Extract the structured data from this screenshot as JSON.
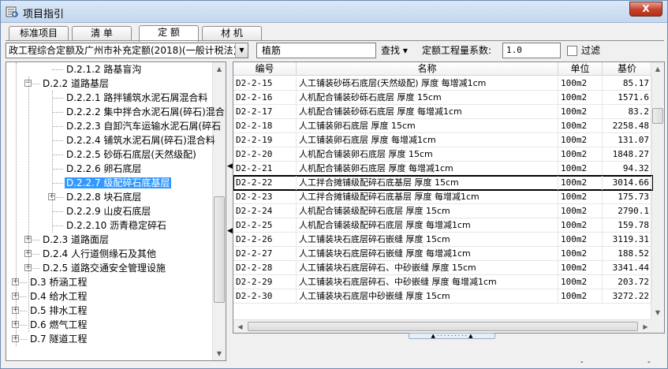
{
  "window": {
    "title": "项目指引",
    "close_label": "X"
  },
  "tabs": [
    {
      "label": "标准项目",
      "active": false
    },
    {
      "label": "清 单",
      "active": false
    },
    {
      "label": "定 额",
      "active": true
    },
    {
      "label": "材 机",
      "active": false
    }
  ],
  "toolbar": {
    "quota_select_value": "政工程综合定额及广州市补充定额(2018)(一般计税法)",
    "search_value": "植筋",
    "find_label": "查找 ▾",
    "coef_label": "定额工程量系数:",
    "coef_value": "1.0",
    "filter_label": "过滤",
    "filter_checked": false
  },
  "tree": {
    "rows": [
      {
        "label": "D.2.1.2 路基盲沟",
        "expander": ""
      },
      {
        "label": "D.2.2 道路基层",
        "expander": "−"
      },
      {
        "label": "D.2.2.1 路拌铺筑水泥石屑混合料",
        "expander": ""
      },
      {
        "label": "D.2.2.2 集中拌合水泥石屑(碎石)混合",
        "expander": ""
      },
      {
        "label": "D.2.2.3 自卸汽车运输水泥石屑(碎石",
        "expander": ""
      },
      {
        "label": "D.2.2.4 铺筑水泥石屑(碎石)混合料",
        "expander": ""
      },
      {
        "label": "D.2.2.5 砂砾石底层(天然级配)",
        "expander": ""
      },
      {
        "label": "D.2.2.6 卵石底层",
        "expander": ""
      },
      {
        "label": "D.2.2.7 级配碎石底基层",
        "expander": "",
        "selected": true
      },
      {
        "label": "D.2.2.8 块石底层",
        "expander": "+"
      },
      {
        "label": "D.2.2.9 山皮石底层",
        "expander": ""
      },
      {
        "label": "D.2.2.10 沥青稳定碎石",
        "expander": ""
      },
      {
        "label": "D.2.3 道路面层",
        "expander": "+"
      },
      {
        "label": "D.2.4 人行道侧缘石及其他",
        "expander": "+"
      },
      {
        "label": "D.2.5 道路交通安全管理设施",
        "expander": "+"
      },
      {
        "label": "D.3 桥涵工程",
        "expander": "+"
      },
      {
        "label": "D.4 给水工程",
        "expander": "+"
      },
      {
        "label": "D.5 排水工程",
        "expander": "+"
      },
      {
        "label": "D.6 燃气工程",
        "expander": "+"
      },
      {
        "label": "D.7 隧道工程",
        "expander": "+"
      }
    ]
  },
  "grid": {
    "columns": [
      "编号",
      "名称",
      "单位",
      "基价"
    ],
    "rows": [
      {
        "code": "D2-2-15",
        "name": "人工铺装砂砾石底层(天然级配) 厚度 每增减1cm",
        "unit": "100m2",
        "price": "85.17"
      },
      {
        "code": "D2-2-16",
        "name": "人机配合铺装砂砾石底层 厚度 15cm",
        "unit": "100m2",
        "price": "1571.6"
      },
      {
        "code": "D2-2-17",
        "name": "人机配合铺装砂砾石底层 厚度 每增减1cm",
        "unit": "100m2",
        "price": "83.2"
      },
      {
        "code": "D2-2-18",
        "name": "人工铺装卵石底层 厚度 15cm",
        "unit": "100m2",
        "price": "2258.48"
      },
      {
        "code": "D2-2-19",
        "name": "人工铺装卵石底层 厚度 每增减1cm",
        "unit": "100m2",
        "price": "131.07"
      },
      {
        "code": "D2-2-20",
        "name": "人机配合铺装卵石底层 厚度 15cm",
        "unit": "100m2",
        "price": "1848.27"
      },
      {
        "code": "D2-2-21",
        "name": "人机配合铺装卵石底层 厚度 每增减1cm",
        "unit": "100m2",
        "price": "94.32"
      },
      {
        "code": "D2-2-22",
        "name": "人工拌合摊铺级配碎石底基层 厚度 15cm",
        "unit": "100m2",
        "price": "3014.66",
        "selected": true
      },
      {
        "code": "D2-2-23",
        "name": "人工拌合摊铺级配碎石底基层 厚度 每增减1cm",
        "unit": "100m2",
        "price": "175.73"
      },
      {
        "code": "D2-2-24",
        "name": "人机配合铺装级配碎石底层 厚度 15cm",
        "unit": "100m2",
        "price": "2790.1"
      },
      {
        "code": "D2-2-25",
        "name": "人机配合铺装级配碎石底层 厚度 每增减1cm",
        "unit": "100m2",
        "price": "159.78"
      },
      {
        "code": "D2-2-26",
        "name": "人工铺装块石底层碎石嵌缝 厚度 15cm",
        "unit": "100m2",
        "price": "3119.31"
      },
      {
        "code": "D2-2-27",
        "name": "人工铺装块石底层碎石嵌缝 厚度 每增减1cm",
        "unit": "100m2",
        "price": "188.52"
      },
      {
        "code": "D2-2-28",
        "name": "人工铺装块石底层碎石、中砂嵌缝 厚度 15cm",
        "unit": "100m2",
        "price": "3341.44"
      },
      {
        "code": "D2-2-29",
        "name": "人工铺装块石底层碎石、中砂嵌缝 厚度 每增减1cm",
        "unit": "100m2",
        "price": "203.72"
      },
      {
        "code": "D2-2-30",
        "name": "人工铺装块石底层中砂嵌缝 厚度 15cm",
        "unit": "100m2",
        "price": "3272.22"
      }
    ]
  },
  "statusbar": {
    "left_mark": "-",
    "right_mark": "-"
  },
  "colors": {
    "selection": "#3399ff",
    "title_gradient_top": "#dbe8f7",
    "close_red": "#c5402a"
  }
}
